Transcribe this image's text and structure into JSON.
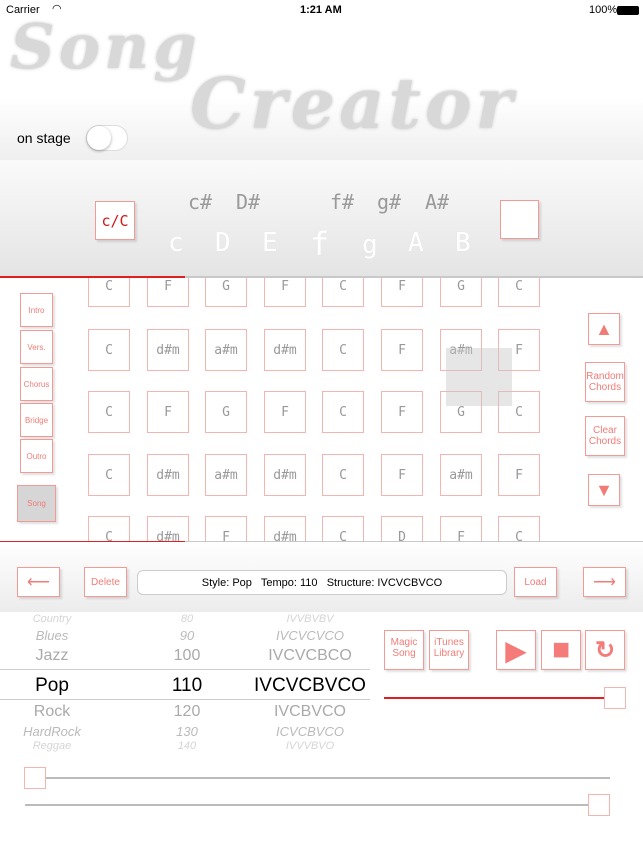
{
  "status": {
    "carrier": "Carrier",
    "time": "1:21 AM",
    "battery": "100%"
  },
  "logo": {
    "line1": "Song",
    "line2": "Creator"
  },
  "on_stage": {
    "label": "on stage",
    "on": false
  },
  "keys": {
    "mode_label": "c/C",
    "sharps": [
      "c#",
      "D#",
      "f#",
      "g#",
      "A#"
    ],
    "naturals": [
      "c",
      "D",
      "E",
      "f",
      "g",
      "A",
      "B"
    ]
  },
  "sections": [
    "Intro",
    "Vers.",
    "Chorus",
    "Bridge",
    "Outro",
    "Song"
  ],
  "grid": [
    [
      "C",
      "F",
      "G",
      "F",
      "C",
      "F",
      "G",
      "C"
    ],
    [
      "C",
      "d#m",
      "a#m",
      "d#m",
      "C",
      "F",
      "a#m",
      "F"
    ],
    [
      "C",
      "F",
      "G",
      "F",
      "C",
      "F",
      "G",
      "C"
    ],
    [
      "C",
      "d#m",
      "a#m",
      "d#m",
      "C",
      "F",
      "a#m",
      "F"
    ],
    [
      "C",
      "d#m",
      "F",
      "d#m",
      "C",
      "D",
      "F",
      "C"
    ]
  ],
  "right": {
    "up": "▲",
    "random": "Random Chords",
    "clear": "Clear Chords",
    "down": "▼"
  },
  "toolbar": {
    "prev": "⟵",
    "delete": "Delete",
    "info": "Style: Pop   Tempo: 110   Structure: IVCVCBVCO",
    "load": "Load",
    "next": "⟶"
  },
  "picker": {
    "styles": [
      "Country",
      "Blues",
      "Jazz",
      "Pop",
      "Rock",
      "HardRock",
      "Reggae"
    ],
    "tempos": [
      "80",
      "90",
      "100",
      "110",
      "120",
      "130",
      "140"
    ],
    "structures": [
      "IVVBVBV",
      "IVCVCVCO",
      "IVCVCBCO",
      "IVCVCBVCO",
      "IVCBVCO",
      "ICVCBVCO",
      "IVVVBVO"
    ],
    "selected_index": 3
  },
  "buttons": {
    "magic": "Magic Song",
    "itunes": "iTunes Library",
    "play": "▶",
    "stop": "■",
    "repeat": "↻"
  },
  "sliders": {
    "volume": 1.0,
    "slider1": 0.0,
    "slider2": 1.0
  },
  "colors": {
    "accent": "#f07c77",
    "progress": "#e02020"
  }
}
